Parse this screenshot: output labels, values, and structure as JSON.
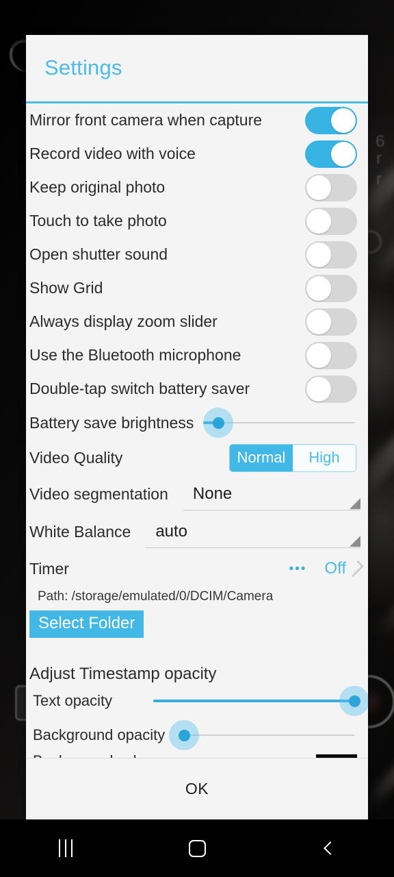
{
  "dialog": {
    "title": "Settings",
    "ok_label": "OK"
  },
  "toggles": [
    {
      "label": "Mirror front camera when capture",
      "state": "on"
    },
    {
      "label": "Record video with voice",
      "state": "on"
    },
    {
      "label": "Keep original photo",
      "state": "off"
    },
    {
      "label": "Touch to take photo",
      "state": "off"
    },
    {
      "label": "Open shutter sound",
      "state": "off"
    },
    {
      "label": "Show Grid",
      "state": "off"
    },
    {
      "label": "Always display zoom slider",
      "state": "off"
    },
    {
      "label": "Use the Bluetooth microphone",
      "state": "off"
    },
    {
      "label": "Double-tap switch battery saver",
      "state": "off"
    }
  ],
  "battery_brightness": {
    "label": "Battery save brightness",
    "value_percent": 10
  },
  "video_quality": {
    "label": "Video Quality",
    "options": [
      "Normal",
      "High"
    ],
    "selected": "Normal"
  },
  "video_segmentation": {
    "label": "Video segmentation",
    "value": "None"
  },
  "white_balance": {
    "label": "White Balance",
    "value": "auto"
  },
  "timer": {
    "label": "Timer",
    "more_icon": "•••",
    "value": "Off"
  },
  "storage": {
    "path": "Path: /storage/emulated/0/DCIM/Camera",
    "select_folder_label": "Select Folder"
  },
  "timestamp": {
    "heading": "Adjust Timestamp opacity",
    "text_opacity": {
      "label": "Text opacity",
      "value_percent": 100
    },
    "background_opacity": {
      "label": "Background opacity",
      "value_percent": 0
    },
    "background_color": {
      "label": "Background color",
      "swatch_hex": "#000000"
    }
  },
  "nav_bar": {
    "recents_label": "Recents",
    "home_label": "Home",
    "back_label": "Back"
  },
  "colors": {
    "accent": "#4cbbe8",
    "toggle_on": "#37b4e3",
    "toggle_off": "#d6d6d6",
    "dialog_bg": "#f4f4f4",
    "text": "#2b2b2b"
  }
}
